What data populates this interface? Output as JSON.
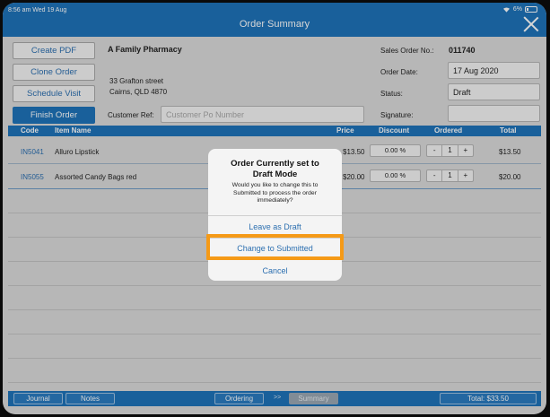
{
  "status_bar": {
    "time": "8:56 am  Wed 19 Aug",
    "battery": "6%"
  },
  "nav": {
    "title": "Order Summary"
  },
  "actions": {
    "create_pdf": "Create PDF",
    "clone_order": "Clone Order",
    "schedule_visit": "Schedule Visit",
    "finish_order": "Finish Order"
  },
  "customer": {
    "name": "A Family Pharmacy",
    "address_line1": "33 Grafton street",
    "address_line2": "Cairns, QLD 4870",
    "ref_label": "Customer Ref:",
    "ref_placeholder": "Customer Po Number"
  },
  "order": {
    "number_label": "Sales Order No.:",
    "number": "011740",
    "date_label": "Order Date:",
    "date": "17 Aug 2020",
    "status_label": "Status:",
    "status": "Draft",
    "signature_label": "Signature:"
  },
  "table": {
    "columns": [
      "Code",
      "Item Name",
      "Price",
      "Discount",
      "Ordered",
      "Total"
    ],
    "rows": [
      {
        "code": "IN5041",
        "name": "Alluro Lipstick",
        "price": "$13.50",
        "discount": "0.00 %",
        "qty": "1",
        "total": "$13.50"
      },
      {
        "code": "IN5055",
        "name": "Assorted Candy Bags red",
        "price": "$20.00",
        "discount": "0.00 %",
        "qty": "1",
        "total": "$20.00"
      }
    ],
    "minus": "-",
    "plus": "+"
  },
  "bottom": {
    "journal": "Journal",
    "notes": "Notes",
    "ordering": "Ordering",
    "separator": ">>",
    "summary": "Summary",
    "total": "Total: $33.50"
  },
  "alert": {
    "title": "Order Currently set to Draft Mode",
    "message": "Would you like to change this to Submitted to process the order immediately?",
    "leave_draft": "Leave as Draft",
    "change_submitted": "Change to Submitted",
    "cancel": "Cancel"
  },
  "colors": {
    "brand_blue": "#1e73b9",
    "highlight": "#f59a17"
  }
}
